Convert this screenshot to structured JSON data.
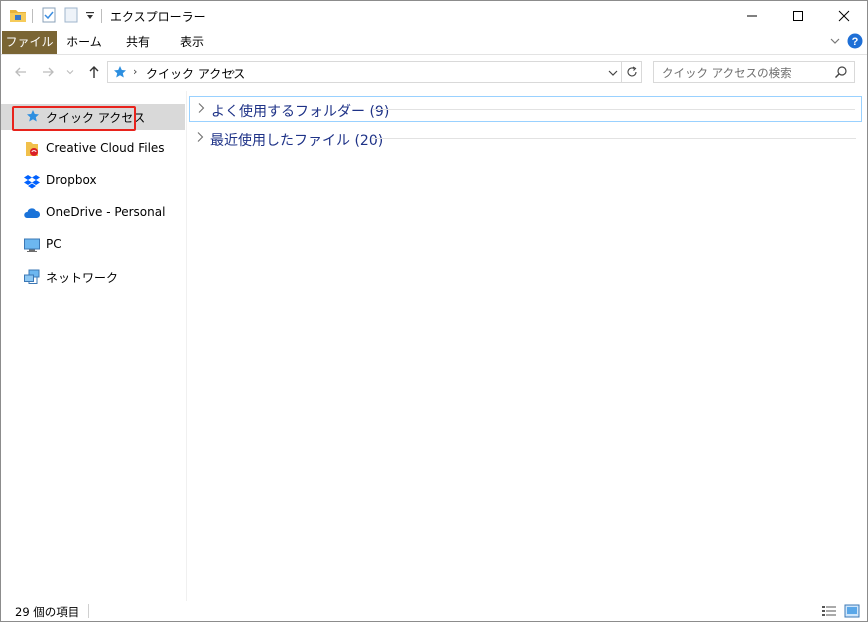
{
  "window": {
    "title": "エクスプローラー"
  },
  "ribbon": {
    "tabs": [
      {
        "label": "ファイル"
      },
      {
        "label": "ホーム"
      },
      {
        "label": "共有"
      },
      {
        "label": "表示"
      }
    ]
  },
  "address": {
    "path": "クイック アクセス",
    "separator": "›"
  },
  "search": {
    "placeholder": "クイック アクセスの検索"
  },
  "sidebar": {
    "items": [
      {
        "label": "クイック アクセス",
        "icon": "star-icon"
      },
      {
        "label": "Creative Cloud Files",
        "icon": "creative-cloud-folder-icon"
      },
      {
        "label": "Dropbox",
        "icon": "dropbox-icon"
      },
      {
        "label": "OneDrive - Personal",
        "icon": "onedrive-cloud-icon"
      },
      {
        "label": "PC",
        "icon": "monitor-icon"
      },
      {
        "label": "ネットワーク",
        "icon": "network-icon"
      }
    ]
  },
  "content": {
    "groups": [
      {
        "label": "よく使用するフォルダー (9)"
      },
      {
        "label": "最近使用したファイル (20)"
      }
    ]
  },
  "status": {
    "item_count": "29 個の項目"
  },
  "colors": {
    "file_tab": "#7a6534",
    "group_label": "#1e3287",
    "highlight": "#e8231c",
    "selected_bg": "#d9d9d9",
    "accent": "#0078d7"
  }
}
